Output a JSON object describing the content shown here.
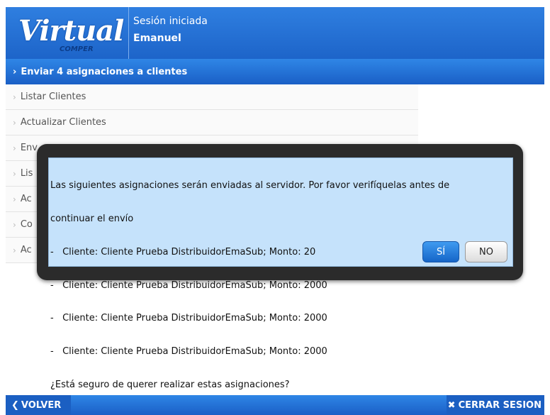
{
  "app": {
    "logo_text": "Virtual",
    "logo_sub": "COMPER"
  },
  "header": {
    "session_label": "Sesión iniciada",
    "user_name": "Emanuel"
  },
  "menu": {
    "active_label": "Enviar 4 asignaciones a clientes",
    "items": [
      {
        "label": "Listar Clientes"
      },
      {
        "label": "Actualizar Clientes"
      },
      {
        "label": "Env"
      },
      {
        "label": "Lis"
      },
      {
        "label": "Ac"
      },
      {
        "label": "Co"
      },
      {
        "label": "Ac"
      }
    ]
  },
  "dialog": {
    "lines": [
      "Las siguientes asignaciones serán enviadas al servidor. Por favor verifíquelas antes de",
      "continuar el envío",
      "-   Cliente: Cliente Prueba DistribuidorEmaSub; Monto: 20",
      "-   Cliente: Cliente Prueba DistribuidorEmaSub; Monto: 2000",
      "-   Cliente: Cliente Prueba DistribuidorEmaSub; Monto: 2000",
      "-   Cliente: Cliente Prueba DistribuidorEmaSub; Monto: 2000",
      "¿Está seguro de querer realizar estas asignaciones?"
    ],
    "yes_label": "SÍ",
    "no_label": "NO"
  },
  "footer": {
    "back_label": "VOLVER",
    "logout_label": "CERRAR SESION"
  },
  "icons": {
    "chevron": "chevron-right-icon",
    "back": "chevron-left-icon",
    "close": "close-icon"
  },
  "colors": {
    "primary": "#1d64c9",
    "dialog_bg": "#c5e2fb",
    "frame": "#2b2b2b"
  }
}
